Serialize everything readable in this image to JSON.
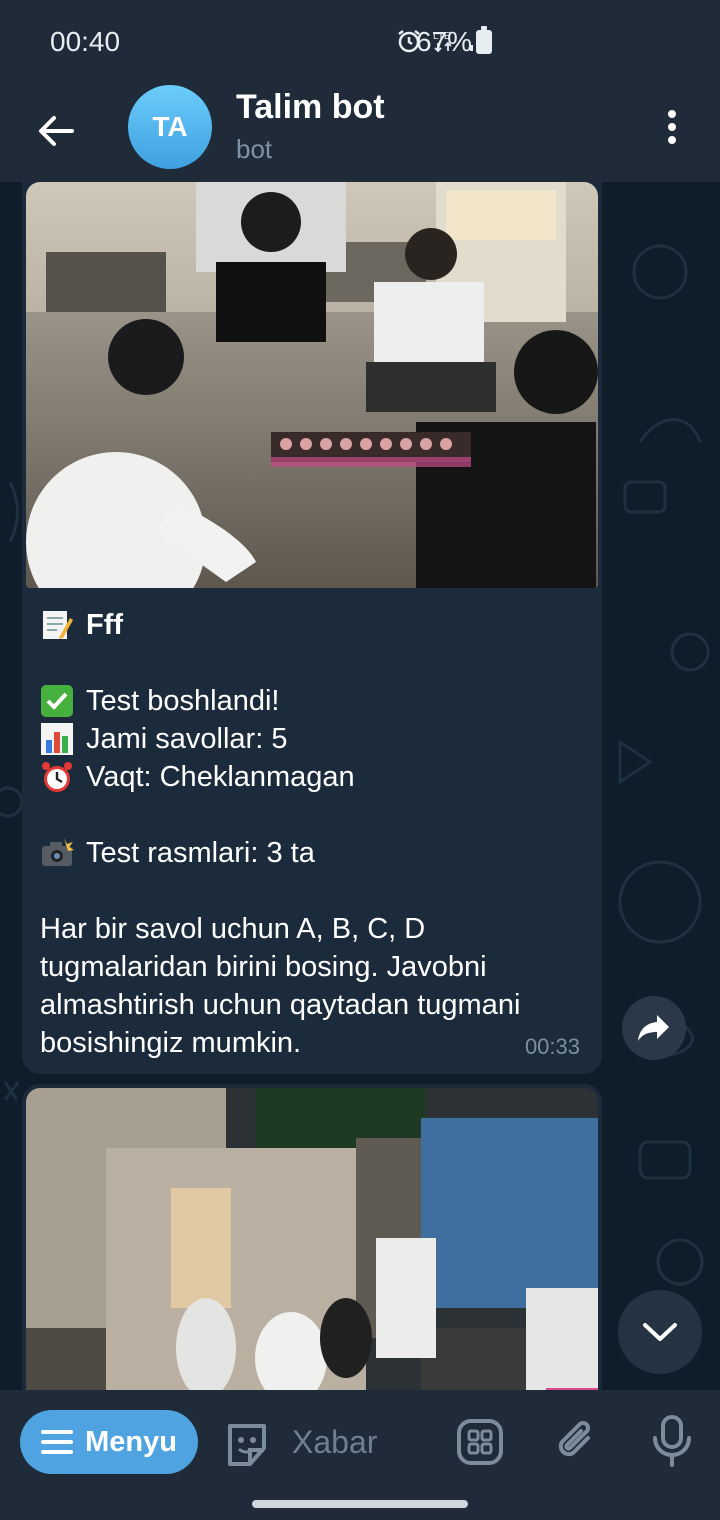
{
  "status_bar": {
    "time": "00:40",
    "network": "LTE",
    "battery_percent": "67%",
    "icons": [
      "alarm-icon",
      "lte-icon",
      "signal-icon",
      "battery-icon"
    ]
  },
  "header": {
    "avatar_initials": "TA",
    "title": "Talim bot",
    "subtitle": "bot",
    "icons": [
      "back-arrow-icon",
      "more-vert-icon"
    ]
  },
  "messages": [
    {
      "type": "photo-caption",
      "title": "Fff",
      "title_emoji": "memo-icon",
      "lines": [
        {
          "emoji": "check-mark-icon",
          "text": "Test boshlandi!"
        },
        {
          "emoji": "bar-chart-icon",
          "text": "Jami savollar: 5"
        },
        {
          "emoji": "alarm-clock-icon",
          "text": "Vaqt: Cheklanmagan"
        }
      ],
      "photos_line": {
        "emoji": "camera-flash-icon",
        "text": "Test rasmlari: 3 ta"
      },
      "instructions": "Har bir savol uchun A, B, C, D tugmalaridan birini bosing. Javobni almashtirish uchun qaytadan tugmani bosishingiz mumkin.",
      "time": "00:33"
    },
    {
      "type": "photo"
    }
  ],
  "composer": {
    "menu_label": "Menyu",
    "placeholder": "Xabar",
    "icons": [
      "menu-lines-icon",
      "sticker-icon",
      "bot-commands-icon",
      "attach-icon",
      "mic-icon"
    ]
  },
  "colors": {
    "header_bg": "#1f2b38",
    "chat_bg": "#0f1c2a",
    "bubble_bg": "#1c2b3b",
    "accent": "#4fa3e0",
    "muted_text": "#7f91a4"
  }
}
